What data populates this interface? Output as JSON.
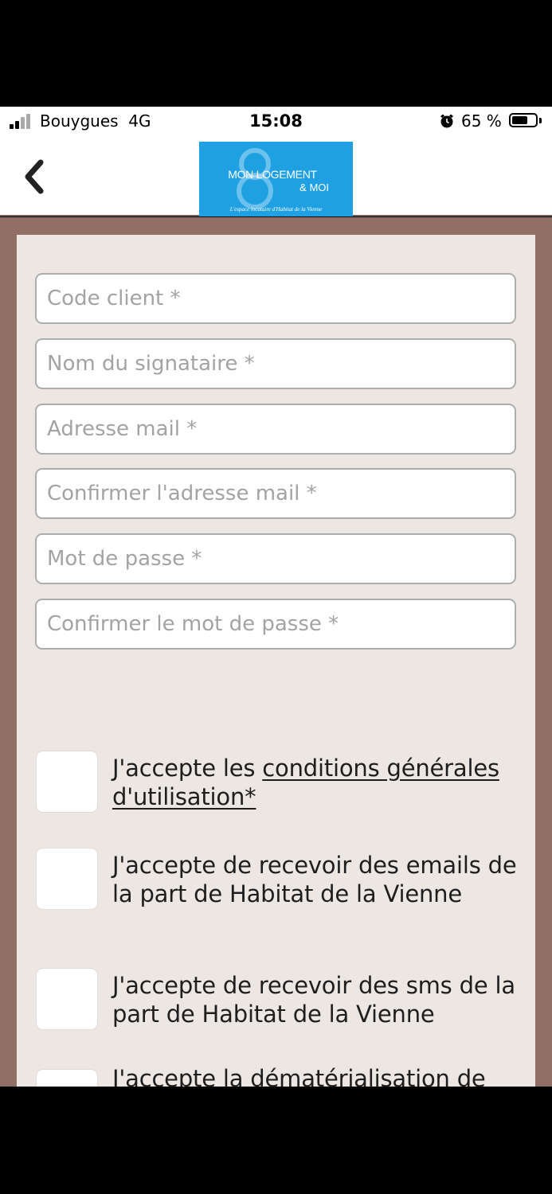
{
  "status_bar": {
    "carrier": "Bouygues",
    "network": "4G",
    "time": "15:08",
    "battery_percent": "65 %",
    "battery_level": 0.65,
    "icons": [
      "signal-icon",
      "alarm-icon",
      "battery-icon"
    ]
  },
  "header": {
    "back_icon": "chevron-left-icon",
    "logo": {
      "line1": "MON LOGEMENT",
      "line2": "& MOI",
      "tagline": "L'espace locataire d'Habitat de la Vienne",
      "color": "#1fa0e3"
    }
  },
  "form": {
    "fields": [
      {
        "placeholder": "Code client *",
        "value": ""
      },
      {
        "placeholder": "Nom du signataire *",
        "value": ""
      },
      {
        "placeholder": "Adresse mail *",
        "value": ""
      },
      {
        "placeholder": "Confirmer l'adresse mail *",
        "value": ""
      },
      {
        "placeholder": "Mot de passe *",
        "value": ""
      },
      {
        "placeholder": "Confirmer le mot de passe *",
        "value": ""
      }
    ],
    "consents": [
      {
        "prefix": "J'accepte les ",
        "link": "conditions générales d'utilisation*",
        "checked": false
      },
      {
        "text": "J'accepte de recevoir des emails de la part de Habitat de la Vienne",
        "checked": false
      },
      {
        "text": "J'accepte de recevoir des sms de la part de Habitat de la Vienne",
        "checked": false
      },
      {
        "text": "J'accepte la dématérialisation de",
        "checked": false
      }
    ]
  },
  "colors": {
    "page_background": "#916f64",
    "card_background": "#ede7e4",
    "logo_blue": "#1fa0e3"
  }
}
